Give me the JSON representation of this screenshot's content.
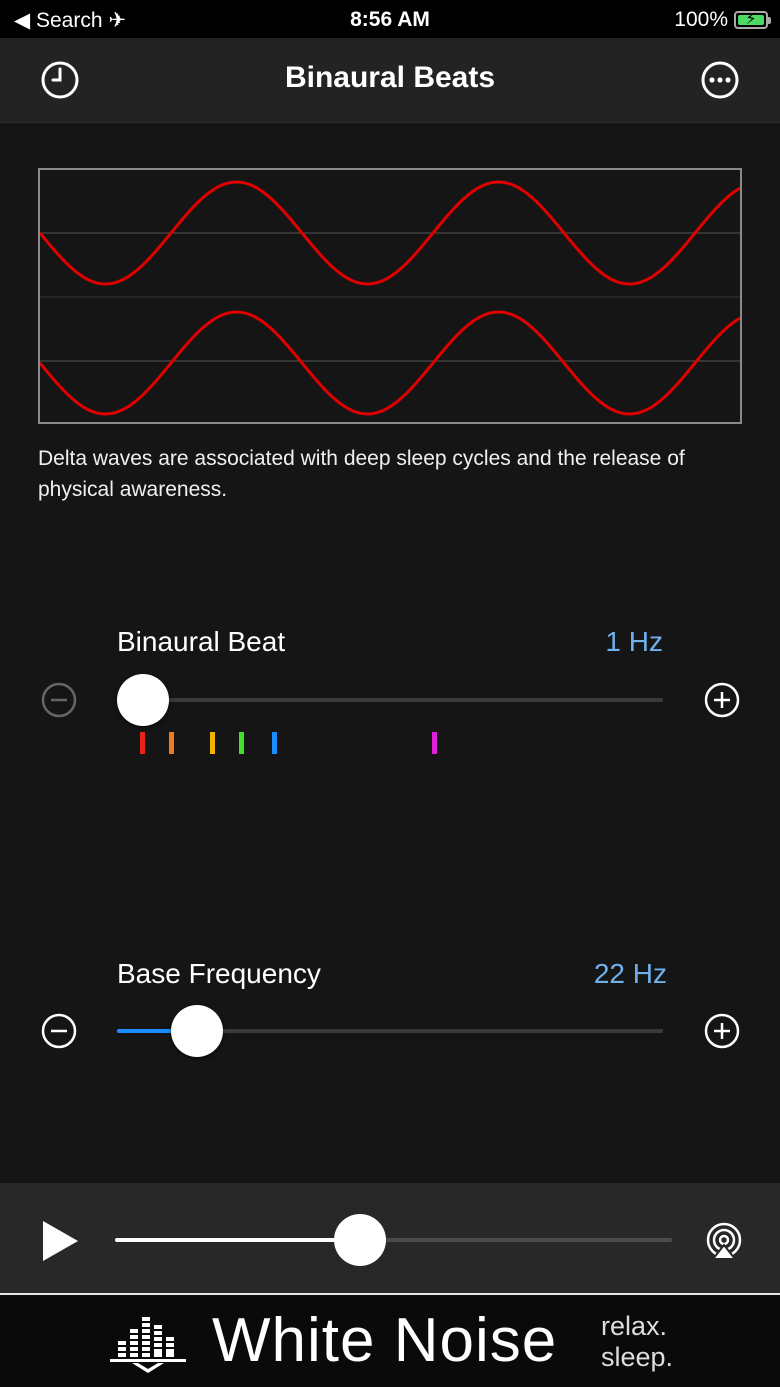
{
  "status_bar": {
    "back_label": "◀ Search",
    "time": "8:56 AM",
    "battery": "100%"
  },
  "nav": {
    "title": "Binaural Beats",
    "left_icon": "clock-icon",
    "right_icon": "more-icon"
  },
  "description": "Delta waves are associated with deep sleep cycles and the release of physical awareness.",
  "binaural_beat": {
    "label": "Binaural Beat",
    "value": "1 Hz",
    "level": 0.0,
    "ticks": [
      {
        "color": "#e8231a"
      },
      {
        "color": "#f07a1e"
      },
      {
        "color": "#f0b400"
      },
      {
        "color": "#3ee02a"
      },
      {
        "color": "#1a8cff"
      },
      {
        "color": "#e020d8"
      }
    ]
  },
  "base_frequency": {
    "label": "Base Frequency",
    "value": "22 Hz",
    "level": 0.11
  },
  "player": {
    "progress": 0.44
  },
  "footer": {
    "brand": "White Noise",
    "tag_line1": "relax.",
    "tag_line2": "sleep."
  },
  "colors": {
    "accent_blue": "#1a8cff",
    "value_blue": "#6fb1ec",
    "wave_red": "#e00000"
  }
}
